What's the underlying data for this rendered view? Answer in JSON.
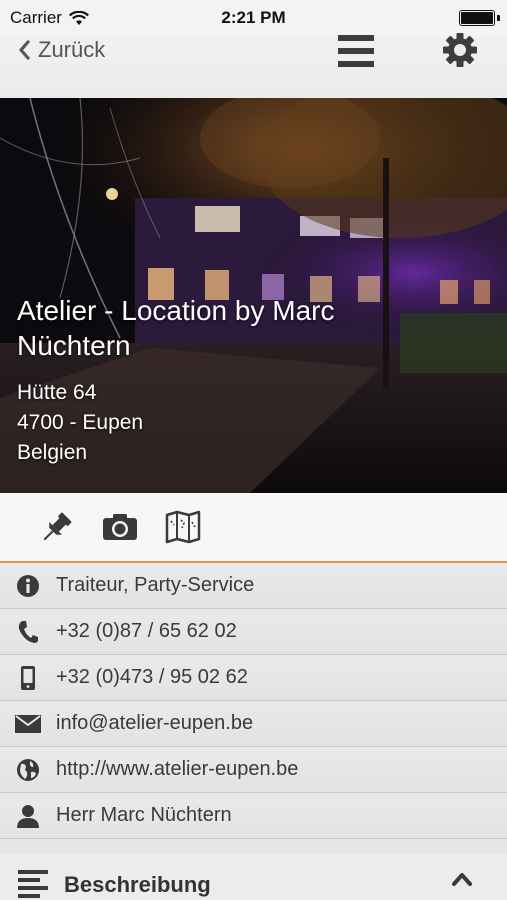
{
  "status": {
    "carrier": "Carrier",
    "time": "2:21 PM",
    "battery_level": 1.0
  },
  "nav": {
    "back_label": "Zurück",
    "menu_icon": "hamburger-menu-icon",
    "settings_icon": "gear-icon"
  },
  "hero": {
    "title": "Atelier - Location by Marc Nüchtern",
    "street": "Hütte 64",
    "city": "4700 - Eupen",
    "country": "Belgien"
  },
  "actions": [
    {
      "icon": "pin-icon"
    },
    {
      "icon": "camera-icon"
    },
    {
      "icon": "map-icon"
    }
  ],
  "info_rows": [
    {
      "icon": "info-icon",
      "text": "Traiteur, Party-Service"
    },
    {
      "icon": "phone-icon",
      "text": "+32 (0)87 / 65 62 02"
    },
    {
      "icon": "mobile-phone-icon",
      "text": "+32 (0)473 / 95 02 62"
    },
    {
      "icon": "envelope-icon",
      "text": "info@atelier-eupen.be"
    },
    {
      "icon": "globe-icon",
      "text": "http://www.atelier-eupen.be"
    },
    {
      "icon": "person-icon",
      "text": "Herr Marc Nüchtern"
    }
  ],
  "description": {
    "title": "Beschreibung",
    "icon": "list-icon",
    "toggle_icon": "chevron-up-icon"
  },
  "colors": {
    "accent": "#e8934a",
    "icon": "#3a3a3a"
  }
}
